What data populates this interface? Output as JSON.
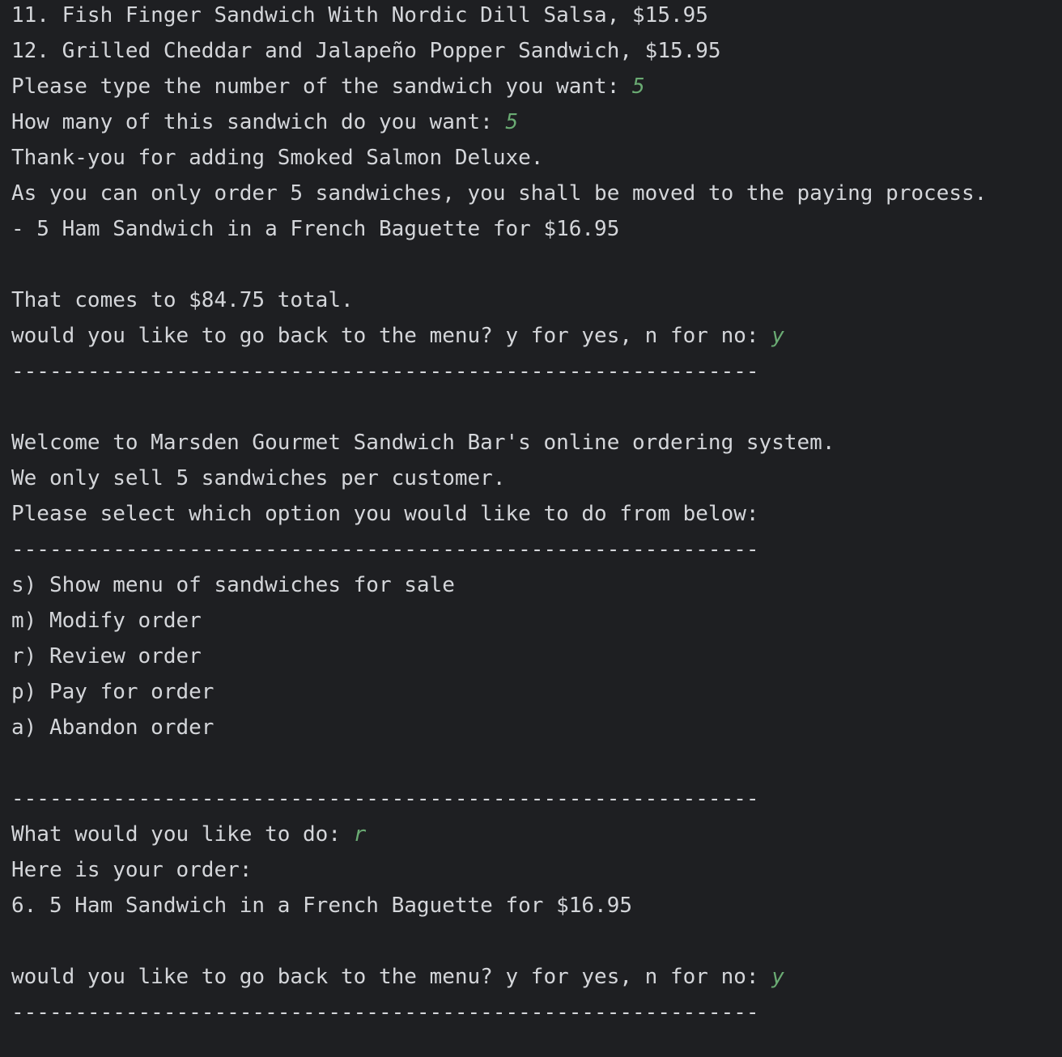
{
  "colors": {
    "background": "#1e1f22",
    "output_text": "#d4d6da",
    "user_input": "#6aab73"
  },
  "console": {
    "lines": [
      {
        "text": "11. Fish Finger Sandwich With Nordic Dill Salsa, $15.95",
        "input": ""
      },
      {
        "text": "12. Grilled Cheddar and Jalapeño Popper Sandwich, $15.95",
        "input": ""
      },
      {
        "text": "Please type the number of the sandwich you want: ",
        "input": "5"
      },
      {
        "text": "How many of this sandwich do you want: ",
        "input": "5"
      },
      {
        "text": "Thank-you for adding Smoked Salmon Deluxe.",
        "input": ""
      },
      {
        "text": "As you can only order 5 sandwiches, you shall be moved to the paying process.",
        "input": ""
      },
      {
        "text": "- 5 Ham Sandwich in a French Baguette for $16.95",
        "input": ""
      },
      {
        "text": "",
        "input": ""
      },
      {
        "text": "That comes to $84.75 total.",
        "input": ""
      },
      {
        "text": "would you like to go back to the menu? y for yes, n for no: ",
        "input": "y"
      },
      {
        "text": "-----------------------------------------------------------",
        "input": ""
      },
      {
        "text": "",
        "input": ""
      },
      {
        "text": "Welcome to Marsden Gourmet Sandwich Bar's online ordering system.",
        "input": ""
      },
      {
        "text": "We only sell 5 sandwiches per customer.",
        "input": ""
      },
      {
        "text": "Please select which option you would like to do from below:",
        "input": ""
      },
      {
        "text": "-----------------------------------------------------------",
        "input": ""
      },
      {
        "text": "s) Show menu of sandwiches for sale",
        "input": ""
      },
      {
        "text": "m) Modify order",
        "input": ""
      },
      {
        "text": "r) Review order",
        "input": ""
      },
      {
        "text": "p) Pay for order",
        "input": ""
      },
      {
        "text": "a) Abandon order",
        "input": ""
      },
      {
        "text": "",
        "input": ""
      },
      {
        "text": "-----------------------------------------------------------",
        "input": ""
      },
      {
        "text": "What would you like to do: ",
        "input": "r"
      },
      {
        "text": "Here is your order:",
        "input": ""
      },
      {
        "text": "6. 5 Ham Sandwich in a French Baguette for $16.95",
        "input": ""
      },
      {
        "text": "",
        "input": ""
      },
      {
        "text": "would you like to go back to the menu? y for yes, n for no: ",
        "input": "y"
      },
      {
        "text": "-----------------------------------------------------------",
        "input": ""
      }
    ]
  }
}
